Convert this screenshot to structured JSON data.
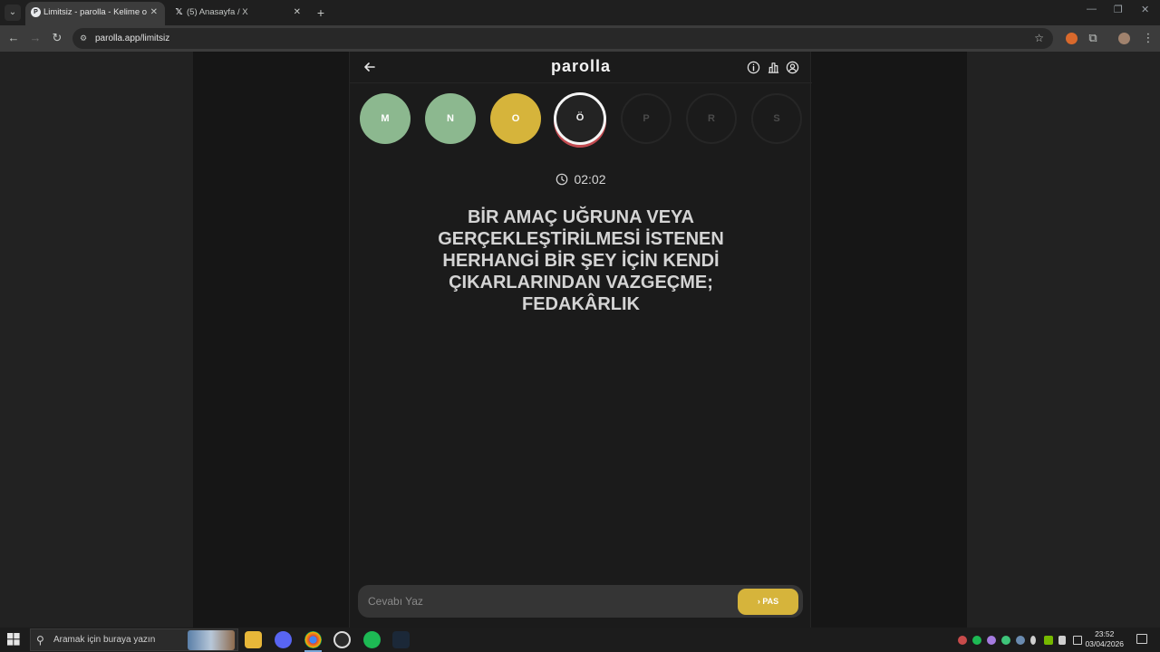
{
  "browser": {
    "tabs": [
      {
        "title": "Limitsiz - parolla - Kelime oyunu",
        "favicon": "parolla-icon",
        "active": true
      },
      {
        "title": "(5) Anasayfa / X",
        "favicon": "x-icon",
        "active": false
      }
    ],
    "url": "parolla.app/limitsiz"
  },
  "app": {
    "logo": "parolla",
    "letters": [
      {
        "char": "M",
        "state": "correct"
      },
      {
        "char": "N",
        "state": "correct"
      },
      {
        "char": "O",
        "state": "passed"
      },
      {
        "char": "Ö",
        "state": "current"
      },
      {
        "char": "P",
        "state": "pending"
      },
      {
        "char": "R",
        "state": "pending"
      },
      {
        "char": "S",
        "state": "pending"
      }
    ],
    "timer": "02:02",
    "question": "BİR AMAÇ UĞRUNA VEYA GERÇEKLEŞTİRİLMESİ İSTENEN HERHANGİ BİR ŞEY İÇİN KENDİ ÇIKARLARINDAN VAZGEÇME; FEDAKÂRLIK",
    "answer_placeholder": "Cevabı Yaz",
    "pass_label": "PAS",
    "colors": {
      "correct": "#8cb88f",
      "passed": "#d6b43b",
      "current_ring": "#c24a50"
    }
  },
  "taskbar": {
    "search_placeholder": "Aramak için buraya yazın",
    "time": "23:52",
    "date": "03/04/2026"
  }
}
